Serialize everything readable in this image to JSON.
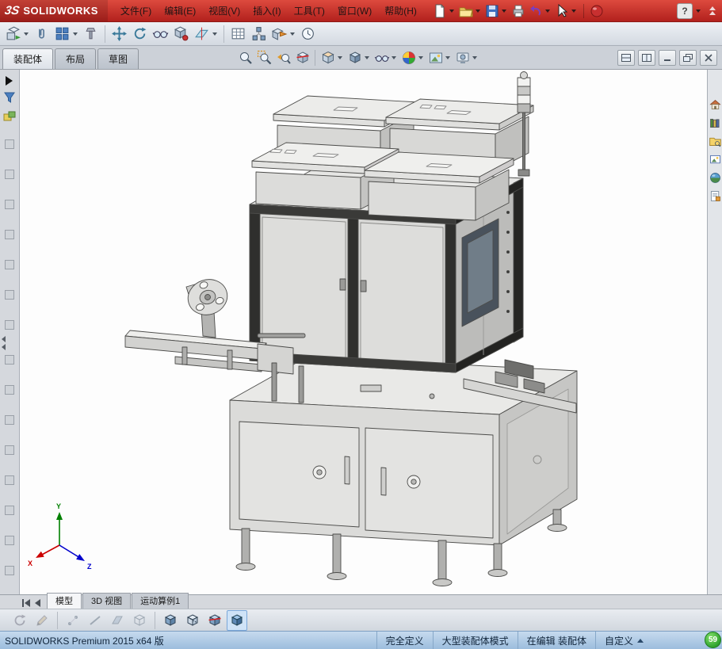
{
  "brand": {
    "mark": "3S",
    "name": "SOLIDWORKS"
  },
  "menubar": [
    {
      "label": "文件(F)"
    },
    {
      "label": "编辑(E)"
    },
    {
      "label": "视图(V)"
    },
    {
      "label": "插入(I)"
    },
    {
      "label": "工具(T)"
    },
    {
      "label": "窗口(W)"
    },
    {
      "label": "帮助(H)"
    }
  ],
  "quick_toolbar": {
    "icons": [
      "new-document",
      "open",
      "save",
      "print",
      "undo",
      "select",
      "rebuild",
      "help",
      "collapse-menu"
    ]
  },
  "assembly_toolbar": {
    "icons": [
      "insert-components",
      "mate",
      "linear-component-pattern",
      "smart-fasteners",
      "move-component",
      "rotate-component",
      "show-hidden-components",
      "assembly-features",
      "reference-geometry",
      "bill-of-materials",
      "exploded-view",
      "instant-3d",
      "new-motion-study"
    ]
  },
  "command_tabs": {
    "items": [
      {
        "label": "装配体",
        "active": true
      },
      {
        "label": "布局",
        "active": false
      },
      {
        "label": "草图",
        "active": false
      }
    ]
  },
  "headsup_toolbar": {
    "icons": [
      "zoom-to-fit",
      "zoom-to-area",
      "previous-view",
      "section-view",
      "view-orientation",
      "display-style",
      "hide-show-items",
      "edit-appearance",
      "apply-scene",
      "view-settings"
    ]
  },
  "window_controls": {
    "icons": [
      "tile-horizontal",
      "tile-vertical",
      "minimize",
      "restore",
      "close"
    ]
  },
  "taskpane": {
    "icons": [
      "solidworks-resources",
      "design-library",
      "file-explorer",
      "view-palette",
      "appearances-scenes",
      "custom-properties"
    ]
  },
  "feature_panel": {
    "icons": [
      "flyout-expand",
      "selection-filter",
      "favorites"
    ]
  },
  "document_tabs": {
    "items": [
      {
        "label": "模型",
        "active": true
      },
      {
        "label": "3D 视图",
        "active": false
      },
      {
        "label": "运动算例1",
        "active": false
      }
    ]
  },
  "lower_toolbar": {
    "icons": [
      "screen-refresh",
      "edit-part",
      "filter-vertices",
      "filter-edges",
      "filter-faces",
      "filter-bodies",
      "shaded-with-edges",
      "hidden-lines-visible",
      "section-cube",
      "large-assembly-mode"
    ],
    "pressed": "large-assembly-mode"
  },
  "statusbar": {
    "left_text": "SOLIDWORKS Premium 2015 x64 版",
    "fully_defined": "完全定义",
    "large_assembly_mode": "大型装配体模式",
    "editing_text": "在编辑 装配体",
    "custom_label": "自定义",
    "badge": "59"
  },
  "viewport": {
    "triad": {
      "x": "X",
      "y": "Y",
      "z": "Z"
    }
  },
  "colors": {
    "titlebar_red": "#c1272d",
    "status_blue": "#a9c7e8",
    "badge_green": "#35b235",
    "accent_blue": "#2f6fb2"
  }
}
